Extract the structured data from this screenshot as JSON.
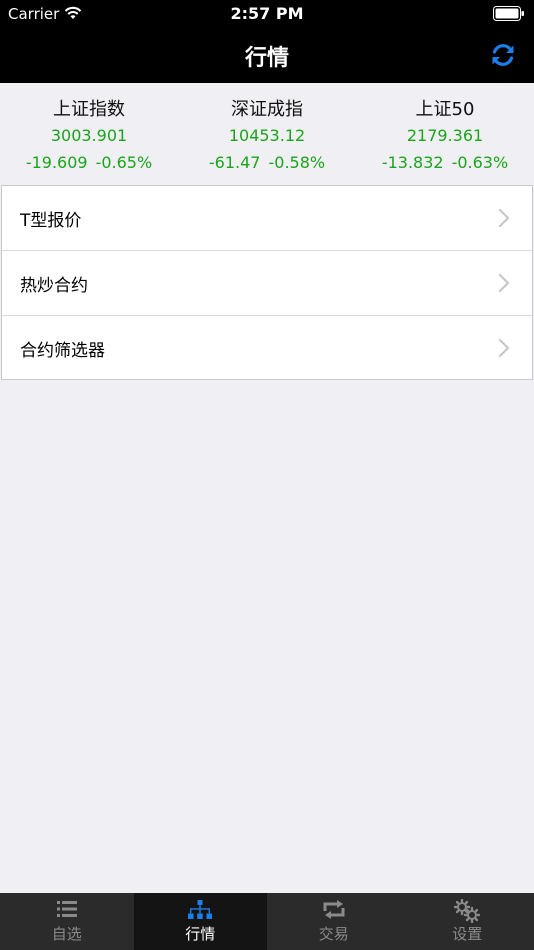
{
  "status": {
    "carrier": "Carrier",
    "time": "2:57 PM"
  },
  "nav": {
    "title": "行情",
    "refresh_icon": "refresh-icon",
    "accent_color": "#1a7fe8"
  },
  "indices": [
    {
      "name": "上证指数",
      "value": "3003.901",
      "change": "-19.609",
      "change_pct": "-0.65%"
    },
    {
      "name": "深证成指",
      "value": "10453.12",
      "change": "-61.47",
      "change_pct": "-0.58%"
    },
    {
      "name": "上证50",
      "value": "2179.361",
      "change": "-13.832",
      "change_pct": "-0.63%"
    }
  ],
  "index_color": "#1aa51a",
  "menu": {
    "items": [
      {
        "label": "T型报价"
      },
      {
        "label": "热炒合约"
      },
      {
        "label": "合约筛选器"
      }
    ]
  },
  "tabs": [
    {
      "label": "自选",
      "icon": "list-icon",
      "active": false
    },
    {
      "label": "行情",
      "icon": "hierarchy-icon",
      "active": true
    },
    {
      "label": "交易",
      "icon": "exchange-icon",
      "active": false
    },
    {
      "label": "设置",
      "icon": "gears-icon",
      "active": false
    }
  ]
}
